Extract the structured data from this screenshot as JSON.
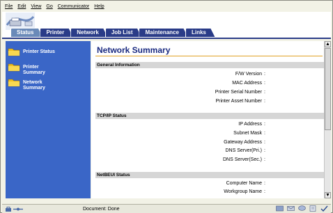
{
  "menu": [
    "File",
    "Edit",
    "View",
    "Go",
    "Communicator",
    "Help"
  ],
  "tabs": [
    {
      "label": "Status",
      "active": true
    },
    {
      "label": "Printer",
      "active": false
    },
    {
      "label": "Network",
      "active": false
    },
    {
      "label": "Job List",
      "active": false
    },
    {
      "label": "Maintenance",
      "active": false
    },
    {
      "label": "Links",
      "active": false
    }
  ],
  "sidebar": {
    "items": [
      {
        "label": "Printer Status",
        "icon": "folder-icon"
      },
      {
        "label": "Printer Summary",
        "icon": "folder-icon"
      },
      {
        "label": "Network Summary",
        "icon": "folder-icon"
      }
    ]
  },
  "main": {
    "title": "Network Summary",
    "sections": [
      {
        "header": "General Information",
        "fields": [
          "F/W Version",
          "MAC Address",
          "Printer Serial Number",
          "Printer Asset Number"
        ]
      },
      {
        "header": "TCP/IP Status",
        "fields": [
          "IP Address",
          "Subnet Mask",
          "Gateway Address",
          "DNS Server(Pri.)",
          "DNS Server(Sec.)"
        ]
      },
      {
        "header": "NetBEUI Status",
        "fields": [
          "Computer Name",
          "Workgroup Name"
        ]
      }
    ]
  },
  "statusbar": {
    "text": "Document: Done"
  },
  "colors": {
    "tab": "#2a3c88",
    "sidebar": "#3a66c7",
    "title": "#1a2a80",
    "accent_rule": "#e0a020"
  }
}
